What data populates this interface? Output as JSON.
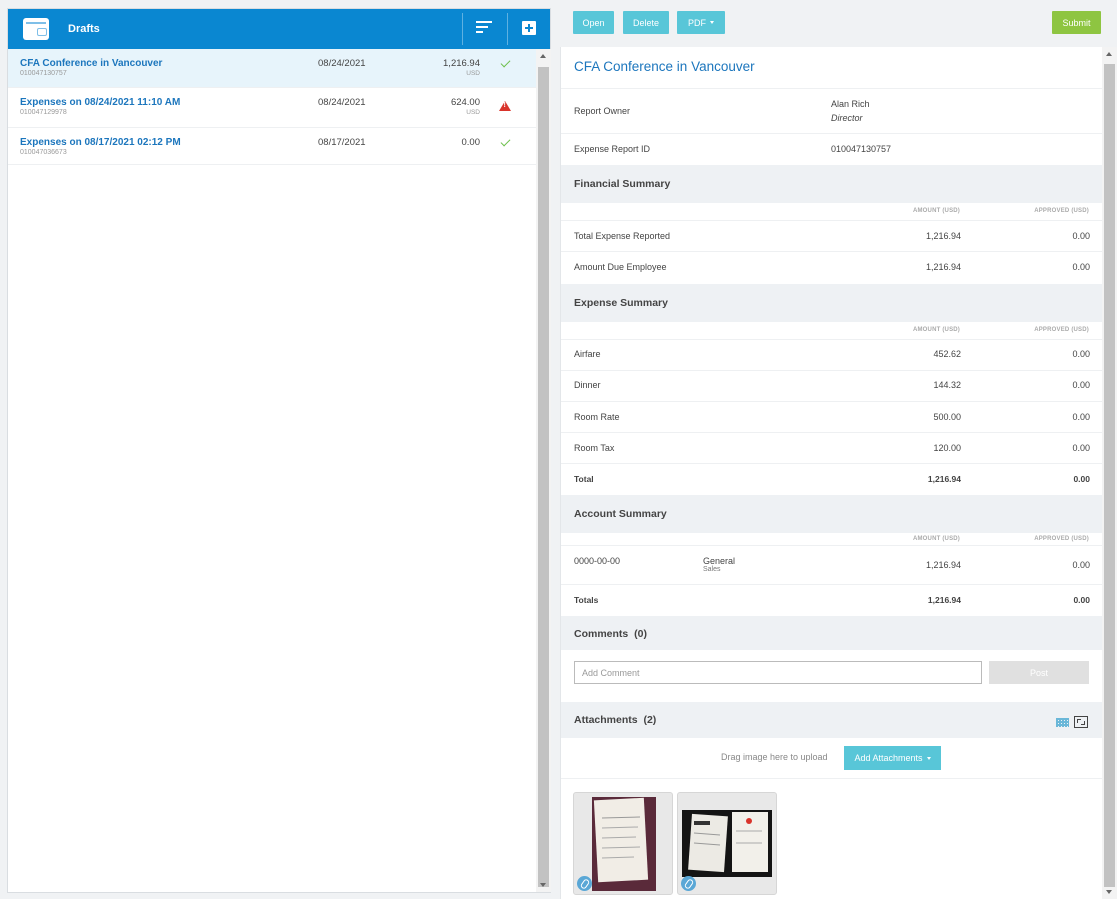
{
  "drafts": {
    "title": "Drafts",
    "items": [
      {
        "title": "CFA Conference in Vancouver",
        "id": "010047130757",
        "date": "08/24/2021",
        "amount": "1,216.94",
        "currency": "USD",
        "status": "ok"
      },
      {
        "title": "Expenses on 08/24/2021 11:10 AM",
        "id": "010047129978",
        "date": "08/24/2021",
        "amount": "624.00",
        "currency": "USD",
        "status": "warning"
      },
      {
        "title": "Expenses on 08/17/2021 02:12 PM",
        "id": "010047036673",
        "date": "08/17/2021",
        "amount": "0.00",
        "currency": "",
        "status": "ok"
      }
    ]
  },
  "toolbar": {
    "open": "Open",
    "delete": "Delete",
    "pdf": "PDF",
    "submit": "Submit"
  },
  "report": {
    "title": "CFA Conference in Vancouver",
    "owner_label": "Report Owner",
    "owner_name": "Alan Rich",
    "owner_role": "Director",
    "id_label": "Expense Report ID",
    "id_value": "010047130757"
  },
  "columns": {
    "amount": "AMOUNT (USD)",
    "approved": "APPROVED (USD)"
  },
  "financial": {
    "title": "Financial Summary",
    "rows": [
      {
        "label": "Total Expense Reported",
        "amount": "1,216.94",
        "approved": "0.00"
      },
      {
        "label": "Amount Due Employee",
        "amount": "1,216.94",
        "approved": "0.00"
      }
    ]
  },
  "expense": {
    "title": "Expense Summary",
    "rows": [
      {
        "label": "Airfare",
        "amount": "452.62",
        "approved": "0.00"
      },
      {
        "label": "Dinner",
        "amount": "144.32",
        "approved": "0.00"
      },
      {
        "label": "Room Rate",
        "amount": "500.00",
        "approved": "0.00"
      },
      {
        "label": "Room Tax",
        "amount": "120.00",
        "approved": "0.00"
      }
    ],
    "total": {
      "label": "Total",
      "amount": "1,216.94",
      "approved": "0.00"
    }
  },
  "account": {
    "title": "Account Summary",
    "row": {
      "code": "0000-00-00",
      "name": "General",
      "sub": "Sales",
      "amount": "1,216.94",
      "approved": "0.00"
    },
    "total": {
      "label": "Totals",
      "amount": "1,216.94",
      "approved": "0.00"
    }
  },
  "comments": {
    "title": "Comments",
    "count": "(0)",
    "placeholder": "Add Comment",
    "post": "Post"
  },
  "attachments": {
    "title": "Attachments",
    "count": "(2)",
    "drag_text": "Drag image here to upload",
    "add_button": "Add Attachments"
  },
  "colors": {
    "header_blue": "#0a87d1",
    "link_blue": "#1c76bd",
    "button_teal": "#58c6d8",
    "submit_green": "#8ec541",
    "ok_green": "#6cbf4a",
    "warn_red": "#d9342b"
  }
}
